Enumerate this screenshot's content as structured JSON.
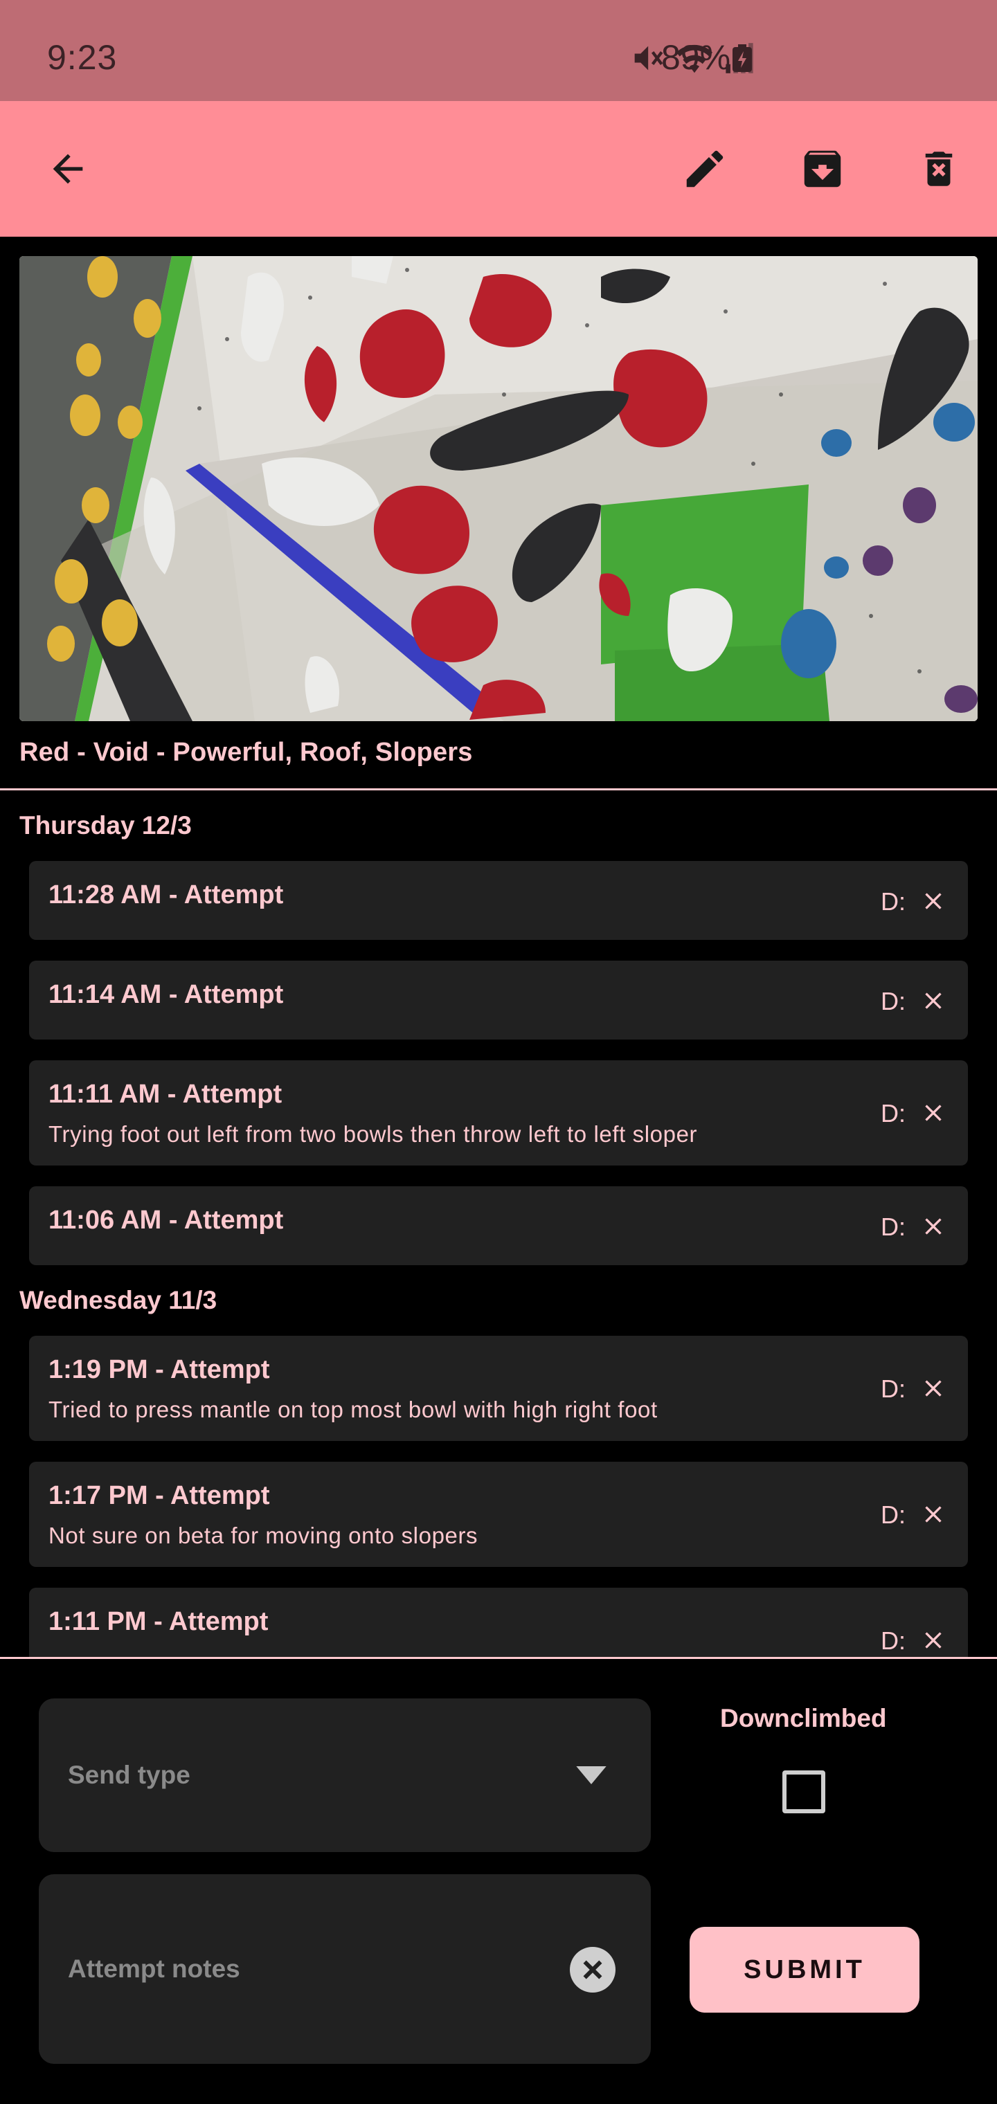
{
  "status_bar": {
    "time": "9:23",
    "battery": "89%"
  },
  "app_bar": {
    "back_icon": "arrow-back-icon",
    "edit_icon": "pencil-icon",
    "archive_icon": "archive-icon",
    "delete_icon": "delete-icon"
  },
  "route": {
    "image": "climbing-wall-photo",
    "title": "Red - Void - Powerful, Roof, Slopers"
  },
  "sessions": [
    {
      "day": "Thursday 12/3",
      "attempts": [
        {
          "title": "11:28 AM - Attempt",
          "note": "",
          "d_label": "D:"
        },
        {
          "title": "11:14 AM - Attempt",
          "note": "",
          "d_label": "D:"
        },
        {
          "title": "11:11 AM - Attempt",
          "note": "Trying foot out left from two bowls then throw left to left sloper",
          "d_label": "D:"
        },
        {
          "title": "11:06 AM - Attempt",
          "note": "",
          "d_label": "D:"
        }
      ]
    },
    {
      "day": "Wednesday 11/3",
      "attempts": [
        {
          "title": "1:19 PM - Attempt",
          "note": "Tried to press mantle on top most bowl with high right foot",
          "d_label": "D:"
        },
        {
          "title": "1:17 PM - Attempt",
          "note": "Not sure on beta for moving onto slopers",
          "d_label": "D:"
        },
        {
          "title": "1:11 PM - Attempt",
          "note": "",
          "d_label": "D:"
        }
      ]
    }
  ],
  "form": {
    "send_type_placeholder": "Send type",
    "notes_placeholder": "Attempt notes",
    "downclimbed_label": "Downclimbed",
    "downclimbed_checked": false,
    "submit_label": "SUBMIT"
  },
  "colors": {
    "status_bar": "#be6c74",
    "app_bar": "#ff8d96",
    "accent_text": "#ffc9cf",
    "card": "#212121",
    "submit": "#ffc1c7"
  }
}
